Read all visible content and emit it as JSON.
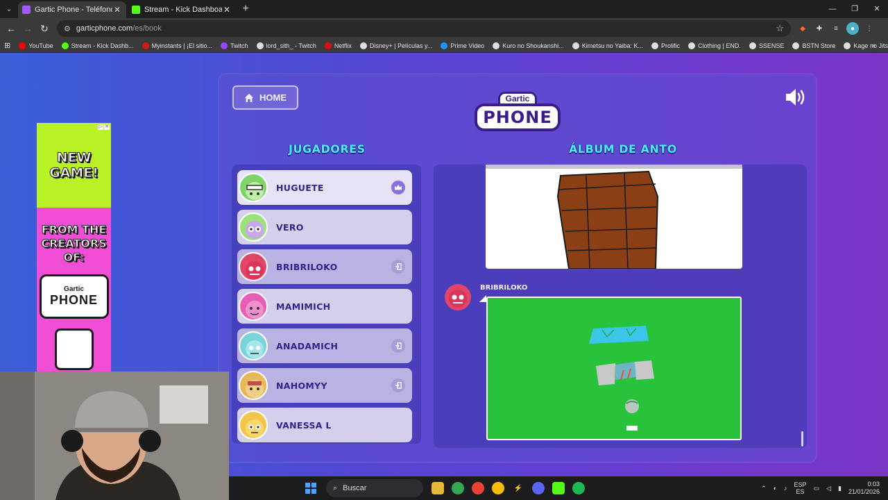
{
  "browser": {
    "tabs": [
      {
        "title": "Gartic Phone - Teléfono Descontrolado",
        "active": true,
        "color": "#a259ff"
      },
      {
        "title": "Stream - Kick Dashboard",
        "active": false,
        "color": "#53fc18"
      }
    ],
    "new_tab": "+",
    "window_controls": {
      "minimize": "—",
      "maximize": "❐",
      "close": "✕"
    },
    "url_host": "garticphone.com",
    "url_path": "/es/book",
    "bookmarks": [
      {
        "label": "YouTube",
        "color": "#ff0000"
      },
      {
        "label": "Stream - Kick Dashb...",
        "color": "#53fc18"
      },
      {
        "label": "Myinstants | ¡El sitio...",
        "color": "#d01919"
      },
      {
        "label": "Twitch",
        "color": "#9146ff"
      },
      {
        "label": "lord_sith_ - Twitch",
        "color": "#dddddd"
      },
      {
        "label": "Netflix",
        "color": "#e50914"
      },
      {
        "label": "Disney+ | Películas y...",
        "color": "#dddddd"
      },
      {
        "label": "Prime Video",
        "color": "#1a98ff"
      },
      {
        "label": "Kuro no Shoukanshi...",
        "color": "#dddddd"
      },
      {
        "label": "Kimetsu no Yaiba: K...",
        "color": "#dddddd"
      },
      {
        "label": "Prolific",
        "color": "#dddddd"
      },
      {
        "label": "Clothing | END.",
        "color": "#dddddd"
      },
      {
        "label": "SSENSE",
        "color": "#dddddd"
      },
      {
        "label": "BSTN Store",
        "color": "#dddddd"
      },
      {
        "label": "Kage no Jitsuryokus...",
        "color": "#dddddd"
      }
    ]
  },
  "ad": {
    "headline": "NEW GAME!",
    "sub": "FROM THE CREATORS OF:",
    "logo_small": "Gartic",
    "logo_big": "PHONE"
  },
  "game": {
    "home_label": "HOME",
    "logo_small": "Gartic",
    "logo_big": "PHONE",
    "players_title": "JUGADORES",
    "album_title": "ÁLBUM DE ANTO",
    "players": [
      {
        "name": "HUGUETE",
        "icon": "crown-icon",
        "avatar_color": "#7fd36b"
      },
      {
        "name": "VERO",
        "icon": "",
        "avatar_color": "#9be07a"
      },
      {
        "name": "BRIBRILOKO",
        "icon": "leave-icon",
        "avatar_color": "#e0456a"
      },
      {
        "name": "MAMIMICH",
        "icon": "",
        "avatar_color": "#e65fb5"
      },
      {
        "name": "ANADAMICH",
        "icon": "leave-icon",
        "avatar_color": "#7ad3d8"
      },
      {
        "name": "NAHOMYY",
        "icon": "leave-icon",
        "avatar_color": "#e7b85a"
      },
      {
        "name": "VANESSA L",
        "icon": "",
        "avatar_color": "#f2c64a"
      }
    ],
    "album_author": "BRIBRILOKO"
  },
  "taskbar": {
    "search_placeholder": "Buscar",
    "lang_top": "ESP",
    "lang_bottom": "ES",
    "time": "0:03",
    "date": "21/01/2026"
  }
}
